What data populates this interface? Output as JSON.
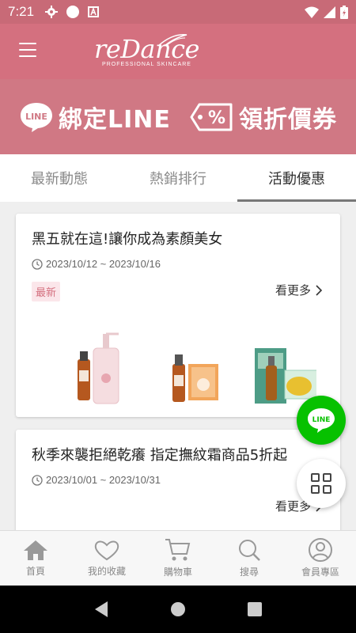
{
  "status_bar": {
    "time": "7:21"
  },
  "header": {
    "logo_main": "reDance",
    "logo_sub": "PROFESSIONAL SKINCARE"
  },
  "promo": {
    "line_badge": "LINE",
    "bind_line": "綁定LINE",
    "coupon_symbol": "%",
    "coupon": "領折價券"
  },
  "tabs": [
    {
      "label": "最新動態"
    },
    {
      "label": "熱銷排行"
    },
    {
      "label": "活動優惠",
      "active": true
    }
  ],
  "cards": [
    {
      "title": "黑五就在這!讓你成為素顏美女",
      "date": "2023/10/12 ~ 2023/10/16",
      "badge": "最新",
      "more": "看更多"
    },
    {
      "title": "秋季來襲拒絕乾癢 指定撫紋霜商品5折起",
      "date": "2023/10/01 ~ 2023/10/31",
      "more": "看更多"
    }
  ],
  "fab": {
    "line_label": "LINE"
  },
  "bottom_nav": [
    {
      "label": "首頁",
      "icon": "home-icon"
    },
    {
      "label": "我的收藏",
      "icon": "heart-icon"
    },
    {
      "label": "購物車",
      "icon": "cart-icon"
    },
    {
      "label": "搜尋",
      "icon": "search-icon"
    },
    {
      "label": "會員專區",
      "icon": "user-icon"
    }
  ],
  "colors": {
    "brand": "#d4707f",
    "status_bar": "#c86a77",
    "line_green": "#07c100"
  }
}
